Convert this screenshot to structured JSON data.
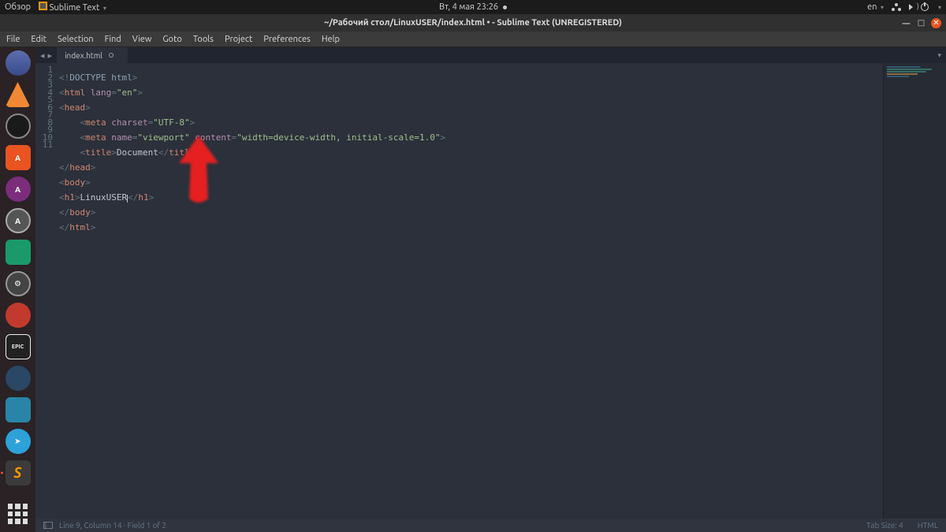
{
  "sysbar": {
    "overview": "Обзор",
    "app_label": "Sublime Text",
    "datetime": "Вт, 4 мая  23:26",
    "lang": "en"
  },
  "window": {
    "title": "~/Рабочий стол/LinuxUSER/index.html • - Sublime Text (UNREGISTERED)"
  },
  "menu": {
    "file": "File",
    "edit": "Edit",
    "selection": "Selection",
    "find": "Find",
    "view": "View",
    "goto": "Goto",
    "tools": "Tools",
    "project": "Project",
    "preferences": "Preferences",
    "help": "Help"
  },
  "tab": {
    "filename": "index.html"
  },
  "code": {
    "l1a": "<!",
    "l1b": "DOCTYPE",
    "l1c": " html",
    "l1d": ">",
    "l2a": "<",
    "l2b": "html",
    "l2c": " lang",
    "l2d": "=",
    "l2e": "\"en\"",
    "l2f": ">",
    "l3a": "<",
    "l3b": "head",
    "l3c": ">",
    "l4a": "<",
    "l4b": "meta",
    "l4c": " charset",
    "l4d": "=",
    "l4e": "\"UTF-8\"",
    "l4f": ">",
    "l5a": "<",
    "l5b": "meta",
    "l5c": " name",
    "l5d": "=",
    "l5e": "\"viewport\"",
    "l5f": " content",
    "l5g": "=",
    "l5h": "\"width=device-width, initial-scale=1.0\"",
    "l5i": ">",
    "l6a": "<",
    "l6b": "title",
    "l6c": ">",
    "l6d": "Document",
    "l6e": "</",
    "l6f": "title",
    "l6g": ">",
    "l7a": "</",
    "l7b": "head",
    "l7c": ">",
    "l8a": "<",
    "l8b": "body",
    "l8c": ">",
    "l9a": "<",
    "l9b": "h1",
    "l9c": ">",
    "l9d": "LinuxUSER",
    "l9e": "</",
    "l9f": "h1",
    "l9g": ">",
    "l10a": "</",
    "l10b": "body",
    "l10c": ">",
    "l11a": "</",
    "l11b": "html",
    "l11c": ">"
  },
  "lines": {
    "n1": "1",
    "n2": "2",
    "n3": "3",
    "n4": "4",
    "n5": "5",
    "n6": "6",
    "n7": "7",
    "n8": "8",
    "n9": "9",
    "n10": "10",
    "n11": "11"
  },
  "status": {
    "pos": "Line 9, Column 14 · Field 1 of 2",
    "tabsize": "Tab Size: 4",
    "syntax": "HTML"
  },
  "dock": {
    "epic_label": "EPIC"
  }
}
